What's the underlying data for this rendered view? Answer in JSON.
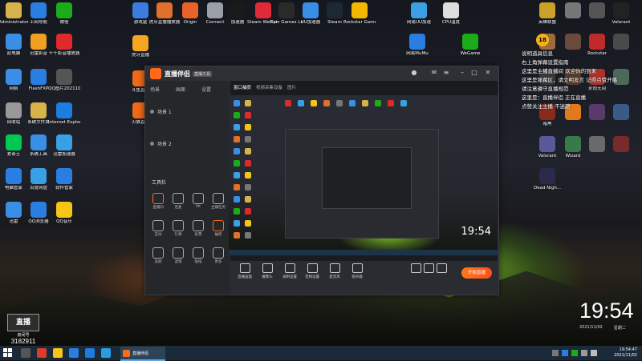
{
  "desktop": {
    "left_column": [
      {
        "label": "Administrator",
        "icon": "user-folder-icon",
        "color": "#d8b24a"
      },
      {
        "label": "上网导航",
        "icon": "browser-icon",
        "color": "#2a7de1"
      },
      {
        "label": "微信",
        "icon": "wechat-icon",
        "color": "#1aad19"
      },
      {
        "label": "此电脑",
        "icon": "computer-icon",
        "color": "#3a8ee6"
      },
      {
        "label": "迅雷影音",
        "icon": "video-player-icon",
        "color": "#f0a020"
      },
      {
        "label": "千千影音播放器",
        "icon": "qq-music-icon",
        "color": "#e02a2a"
      },
      {
        "label": "网络",
        "icon": "network-icon",
        "color": "#3a8ee6"
      },
      {
        "label": "FlashFXP",
        "icon": "flashfxp-icon",
        "color": "#2a7de1"
      },
      {
        "label": "QQ图片20211025",
        "icon": "image-icon",
        "color": "#555555"
      },
      {
        "label": "回收站",
        "icon": "recycle-bin-icon",
        "color": "#999999"
      },
      {
        "label": "系统文件夹",
        "icon": "folder-icon",
        "color": "#d8b24a"
      },
      {
        "label": "Internet Explorer",
        "icon": "ie-icon",
        "color": "#1c7ce0"
      },
      {
        "label": "爱奇艺",
        "icon": "iqiyi-icon",
        "color": "#00c853"
      },
      {
        "label": "系统工具",
        "icon": "tools-icon",
        "color": "#3a8ee6"
      },
      {
        "label": "迅雷加速器",
        "icon": "accelerator-icon",
        "color": "#3aa0e6"
      },
      {
        "label": "电脑管家",
        "icon": "shield-icon",
        "color": "#2a7de1"
      },
      {
        "label": "百度网盘",
        "icon": "cloud-disk-icon",
        "color": "#3aa0e6"
      },
      {
        "label": "软件管家",
        "icon": "software-manager-icon",
        "color": "#2a7de1"
      },
      {
        "label": "迅雷",
        "icon": "thunder-icon",
        "color": "#3a8ee6"
      },
      {
        "label": "QQ浏览器",
        "icon": "qq-browser-icon",
        "color": "#2a7de1"
      },
      {
        "label": "QQ音乐",
        "icon": "qq-music-icon",
        "color": "#f5c518"
      }
    ],
    "top_row": [
      {
        "label": "游戏盒",
        "icon": "game-box-icon",
        "color": "#3a7ce0"
      },
      {
        "label": "虎牙直播播放器",
        "icon": "basketball-icon",
        "color": "#e0702a"
      },
      {
        "label": "Origin",
        "icon": "origin-icon",
        "color": "#e8632a"
      },
      {
        "label": "Connect",
        "icon": "connect-icon",
        "color": "#9aa0a8"
      },
      {
        "label": "加速器",
        "icon": "speed-icon",
        "color": "#1a1a1a"
      },
      {
        "label": "Steam WeGame",
        "icon": "wegame-icon",
        "color": "#e02a3a"
      },
      {
        "label": "Epic Games Launcher",
        "icon": "epic-icon",
        "color": "#2a2a2a"
      },
      {
        "label": "UU加速器",
        "icon": "uu-icon",
        "color": "#3a8ee6"
      },
      {
        "label": "Steam",
        "icon": "steam-icon",
        "color": "#1b2838"
      },
      {
        "label": "Rockstar Games Launcher",
        "icon": "rockstar-icon",
        "color": "#f5b800"
      },
      {
        "label": "网易UU加速",
        "icon": "accelerator-icon",
        "color": "#3aa0e6"
      },
      {
        "label": "CPU温度",
        "icon": "gauge-icon",
        "color": "#dddddd"
      },
      {
        "label": "网易MuMu",
        "icon": "mumu-icon",
        "color": "#2a7de1"
      },
      {
        "label": "WeGame",
        "icon": "star-icon",
        "color": "#1aad19"
      }
    ],
    "middle_icons": [
      {
        "label": "虎牙直播",
        "icon": "huya-icon",
        "color": "#f5a623"
      },
      {
        "label": "斗鱼直播",
        "icon": "douyu-icon",
        "color": "#f06a1a"
      },
      {
        "label": "火猫直播",
        "icon": "cat-icon",
        "color": "#f06a1a"
      }
    ],
    "right_grid": [
      {
        "label": "英雄联盟",
        "icon": "lol-icon",
        "color": "#c8a02a"
      },
      {
        "label": "",
        "icon": "mask-icon",
        "color": "#777777"
      },
      {
        "label": "",
        "icon": "hat-icon",
        "color": "#555555"
      },
      {
        "label": "Valorant",
        "icon": "valorant-icon",
        "color": "#222222"
      },
      {
        "label": "",
        "icon": "game-cover-icon",
        "color": "#a06a3a"
      },
      {
        "label": "",
        "icon": "game-cover-icon",
        "color": "#6a4a3a"
      },
      {
        "label": "Rockstar",
        "icon": "rockstar-icon",
        "color": "#c02a2a"
      },
      {
        "label": "",
        "icon": "game-cover-icon",
        "color": "#4a4a4a"
      },
      {
        "label": "",
        "icon": "game-cover-icon",
        "color": "#3a3a3a"
      },
      {
        "label": "",
        "icon": "game-cover-icon",
        "color": "#5a3a2a"
      },
      {
        "label": "永劫无间",
        "icon": "game-cover-icon",
        "color": "#b0302a"
      },
      {
        "label": "",
        "icon": "game-cover-icon",
        "color": "#4a6a5a"
      },
      {
        "label": "暗黑",
        "icon": "game-cover-icon",
        "color": "#8a2a1a"
      },
      {
        "label": "",
        "icon": "game-cover-icon",
        "color": "#e07a1a"
      },
      {
        "label": "",
        "icon": "game-cover-icon",
        "color": "#5a3a6a"
      },
      {
        "label": "",
        "icon": "game-cover-icon",
        "color": "#3a5a8a"
      },
      {
        "label": "Valorant",
        "icon": "valorant-icon",
        "color": "#5a5a9a"
      },
      {
        "label": "Wizard",
        "icon": "game-cover-icon",
        "color": "#3a7a4a"
      },
      {
        "label": "",
        "icon": "game-cover-icon",
        "color": "#6a6a6a"
      },
      {
        "label": "",
        "icon": "game-cover-icon",
        "color": "#7a2a2a"
      },
      {
        "label": "Dead Nigh...",
        "icon": "game-cover-icon",
        "color": "#2a2a4a"
      }
    ]
  },
  "app": {
    "title": "直播伴侣",
    "badge": "直播工具",
    "sidebar_tabs": [
      "场景",
      "画面",
      "设置"
    ],
    "scenes": [
      "场景 1",
      "场景 2"
    ],
    "tools_header": "工具栏",
    "tools": [
      "直播间",
      "连麦",
      "PK",
      "主播任务",
      "互动",
      "礼物",
      "投票",
      "抽奖",
      "美颜",
      "滤镜",
      "贴纸",
      "更多"
    ],
    "preview_tabs": [
      "窗口捕获",
      "视频采集设备",
      "图片"
    ],
    "preview_clock": "19:54",
    "controls": [
      "直播画面",
      "摄像头",
      "录制设置",
      "音频设置",
      "麦克风",
      "扬声器"
    ],
    "start_live": "开始直播"
  },
  "chat": {
    "badge": "18",
    "lines": [
      "说明道具信息",
      "右上角弹幕设置指南",
      "这里是主播直播间 欢迎你的到来",
      "这里是弹幕区，请文明发言 记得点赞开播",
      "请注意遵守直播规范",
      "这里是：直播伴侣 正在直播",
      "点赞关注主播 不迷路"
    ]
  },
  "stream_overlay": {
    "logo": "直播",
    "subtitle": "房间号",
    "room_number": "3182911"
  },
  "clock": {
    "time": "19:54",
    "date_left": "2021/11/02",
    "date_right": "星期二"
  },
  "taskbar": {
    "active_app": "直播伴侣",
    "tray_time": "19:54:47",
    "tray_date": "2021/11/02"
  }
}
